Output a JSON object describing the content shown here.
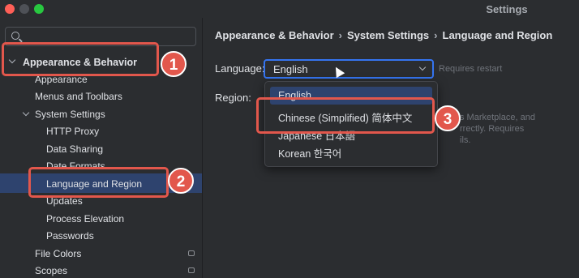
{
  "window": {
    "title": "Settings"
  },
  "sidebar": {
    "search_placeholder": "",
    "items": [
      {
        "label": "Appearance & Behavior"
      },
      {
        "label": "Appearance"
      },
      {
        "label": "Menus and Toolbars"
      },
      {
        "label": "System Settings"
      },
      {
        "label": "HTTP Proxy"
      },
      {
        "label": "Data Sharing"
      },
      {
        "label": "Date Formats"
      },
      {
        "label": "Language and Region"
      },
      {
        "label": "Updates"
      },
      {
        "label": "Process Elevation"
      },
      {
        "label": "Passwords"
      },
      {
        "label": "File Colors"
      },
      {
        "label": "Scopes"
      }
    ]
  },
  "breadcrumb": {
    "a": "Appearance & Behavior",
    "b": "System Settings",
    "c": "Language and Region",
    "separator": "›"
  },
  "form": {
    "language_label": "Language:",
    "language_value": "English",
    "requires_restart": "Requires restart",
    "region_label": "Region:",
    "region_hint_1": "s Marketplace, and",
    "region_hint_2": "rrectly. Requires",
    "region_hint_3": "ils."
  },
  "dropdown": {
    "options": [
      {
        "label": "English"
      },
      {
        "label": "Chinese (Simplified) 简体中文"
      },
      {
        "label": "Japanese 日本語"
      },
      {
        "label": "Korean 한국어"
      }
    ]
  },
  "annotations": {
    "one": "1",
    "two": "2",
    "three": "3"
  },
  "colors": {
    "accent": "#3574f0",
    "callout": "#e2574c",
    "selection": "#2e436e",
    "background": "#2b2d30"
  }
}
